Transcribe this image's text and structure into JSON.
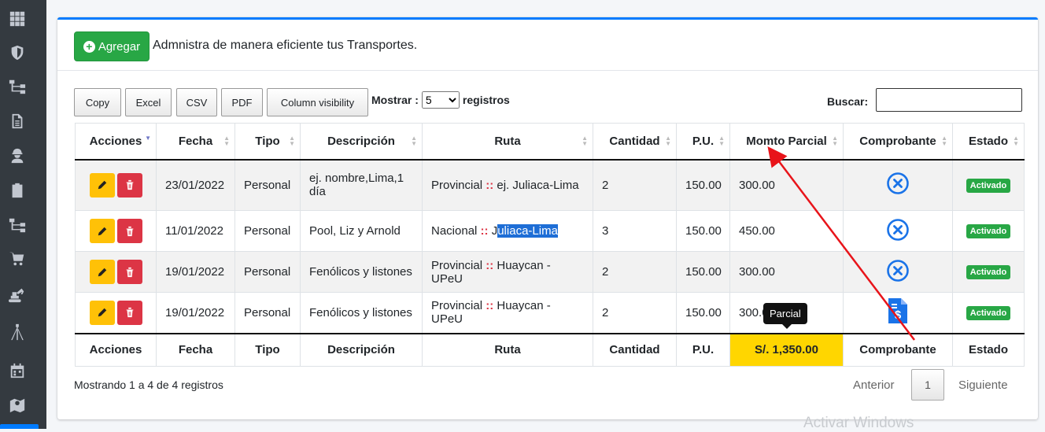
{
  "sidebar": {
    "icons": [
      "grid-icon",
      "shield-icon",
      "sitemap-icon",
      "document-icon",
      "worker-icon",
      "clipboard-icon",
      "sitemap-icon-2",
      "cart-icon",
      "excavator-icon",
      "tripod-icon",
      "calendar-icon",
      "map-icon"
    ]
  },
  "header": {
    "add_label": "Agregar",
    "description": "Admnistra de manera eficiente tus Transportes."
  },
  "toolbar": {
    "copy": "Copy",
    "excel": "Excel",
    "csv": "CSV",
    "pdf": "PDF",
    "colvis": "Column visibility",
    "show_label": "Mostrar :",
    "show_value": "5",
    "show_suffix": "registros",
    "search_label": "Buscar:"
  },
  "table": {
    "columns": [
      "Acciones",
      "Fecha",
      "Tipo",
      "Descripción",
      "Ruta",
      "Cantidad",
      "P.U.",
      "Momto Parcial",
      "Comprobante",
      "Estado"
    ],
    "footer": [
      "Acciones",
      "Fecha",
      "Tipo",
      "Descripción",
      "Ruta",
      "Cantidad",
      "P.U.",
      "S/. 1,350.00",
      "Comprobante",
      "Estado"
    ],
    "rows": [
      {
        "fecha": "23/01/2022",
        "tipo": "Personal",
        "descripcion": "ej. nombre,Lima,1 día",
        "ruta_tipo": "Provincial",
        "ruta_sep": "::",
        "ruta": "ej. Juliaca-Lima",
        "cantidad": "2",
        "pu": "150.00",
        "parcial": "300.00",
        "estado": "Activado"
      },
      {
        "fecha": "11/01/2022",
        "tipo": "Personal",
        "descripcion": "Pool, Liz y Arnold",
        "ruta_tipo": "Nacional",
        "ruta_sep": "::",
        "ruta_pre": "J",
        "ruta": "uliaca-Lima",
        "cantidad": "3",
        "pu": "150.00",
        "parcial": "450.00",
        "estado": "Activado"
      },
      {
        "fecha": "19/01/2022",
        "tipo": "Personal",
        "descripcion": "Fenólicos y listones",
        "ruta_tipo": "Provincial",
        "ruta_sep": "::",
        "ruta": "Huaycan - UPeU",
        "cantidad": "2",
        "pu": "150.00",
        "parcial": "300.00",
        "estado": "Activado"
      },
      {
        "fecha": "19/01/2022",
        "tipo": "Personal",
        "descripcion": "Fenólicos y listones",
        "ruta_tipo": "Provincial",
        "ruta_sep": "::",
        "ruta": "Huaycan - UPeU",
        "cantidad": "2",
        "pu": "150.00",
        "parcial": "300.0",
        "estado": "Activado"
      }
    ]
  },
  "tooltip": "Parcial",
  "footer": {
    "info": "Mostrando 1 a 4 de 4 registros",
    "prev": "Anterior",
    "page": "1",
    "next": "Siguiente"
  },
  "watermark": "Activar Windows",
  "colors": {
    "accent": "#007bff",
    "success": "#28a745",
    "warning": "#ffc107",
    "danger": "#dc3545",
    "total_highlight": "#ffd600",
    "annotation_arrow": "#e8141a"
  }
}
